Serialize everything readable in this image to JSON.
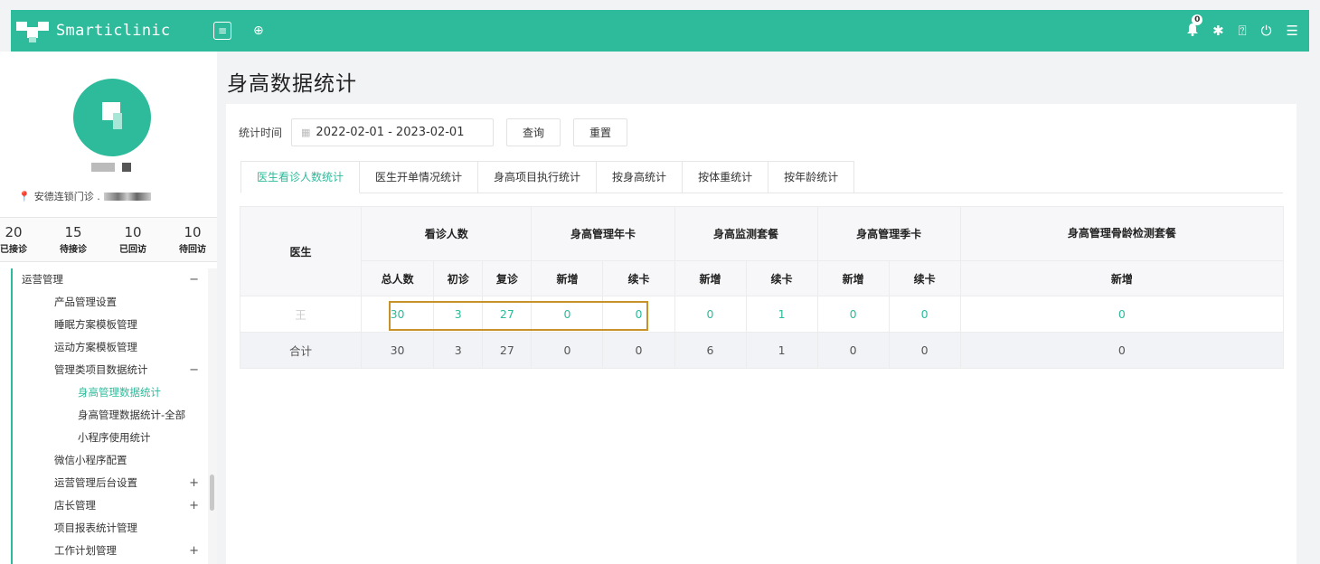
{
  "app": {
    "title": "Smarticlinic"
  },
  "header": {
    "menu_icon": "hamburger-icon",
    "add_icon": "plus-circle-icon",
    "notifications_count": "0",
    "icons": [
      "bell-icon",
      "gear-icon",
      "help-icon",
      "power-icon",
      "list-icon"
    ]
  },
  "sidebar": {
    "clinic": "安德连锁门诊 .",
    "stats": [
      {
        "num": "20",
        "label": "已接诊"
      },
      {
        "num": "15",
        "label": "待接诊"
      },
      {
        "num": "10",
        "label": "已回访"
      },
      {
        "num": "10",
        "label": "待回访"
      }
    ],
    "nav": [
      {
        "label": "运营管理",
        "level": 0,
        "toggle": "−"
      },
      {
        "label": "产品管理设置",
        "level": 1
      },
      {
        "label": "睡眠方案模板管理",
        "level": 1
      },
      {
        "label": "运动方案模板管理",
        "level": 1
      },
      {
        "label": "管理类项目数据统计",
        "level": 1,
        "toggle": "−"
      },
      {
        "label": "身高管理数据统计",
        "level": 2,
        "active": true
      },
      {
        "label": "身高管理数据统计-全部",
        "level": 2
      },
      {
        "label": "小程序使用统计",
        "level": 2
      },
      {
        "label": "微信小程序配置",
        "level": 1
      },
      {
        "label": "运营管理后台设置",
        "level": 1,
        "toggle": "+"
      },
      {
        "label": "店长管理",
        "level": 1,
        "toggle": "+"
      },
      {
        "label": "项目报表统计管理",
        "level": 1
      },
      {
        "label": "工作计划管理",
        "level": 1,
        "toggle": "+"
      }
    ]
  },
  "page": {
    "title": "身高数据统计",
    "filter": {
      "label": "统计时间",
      "date_range": "2022-02-01 - 2023-02-01",
      "query_button": "查询",
      "reset_button": "重置"
    },
    "tabs": [
      "医生看诊人数统计",
      "医生开单情况统计",
      "身高项目执行统计",
      "按身高统计",
      "按体重统计",
      "按年龄统计"
    ],
    "active_tab": 0,
    "table": {
      "doctor_header": "医生",
      "groups": [
        {
          "label": "看诊人数",
          "cols": [
            "总人数",
            "初诊",
            "复诊"
          ]
        },
        {
          "label": "身高管理年卡",
          "cols": [
            "新增",
            "续卡"
          ]
        },
        {
          "label": "身高监测套餐",
          "cols": [
            "新增",
            "续卡"
          ]
        },
        {
          "label": "身高管理季卡",
          "cols": [
            "新增",
            "续卡"
          ]
        },
        {
          "label": "身高管理骨龄检测套餐",
          "cols": [
            "新增"
          ]
        }
      ],
      "rows": [
        {
          "doctor": "王",
          "values": [
            "30",
            "3",
            "27",
            "0",
            "0",
            "0",
            "1",
            "0",
            "0",
            "0"
          ]
        }
      ],
      "total": {
        "label": "合计",
        "values": [
          "30",
          "3",
          "27",
          "0",
          "0",
          "6",
          "1",
          "0",
          "0",
          "0"
        ]
      }
    }
  }
}
